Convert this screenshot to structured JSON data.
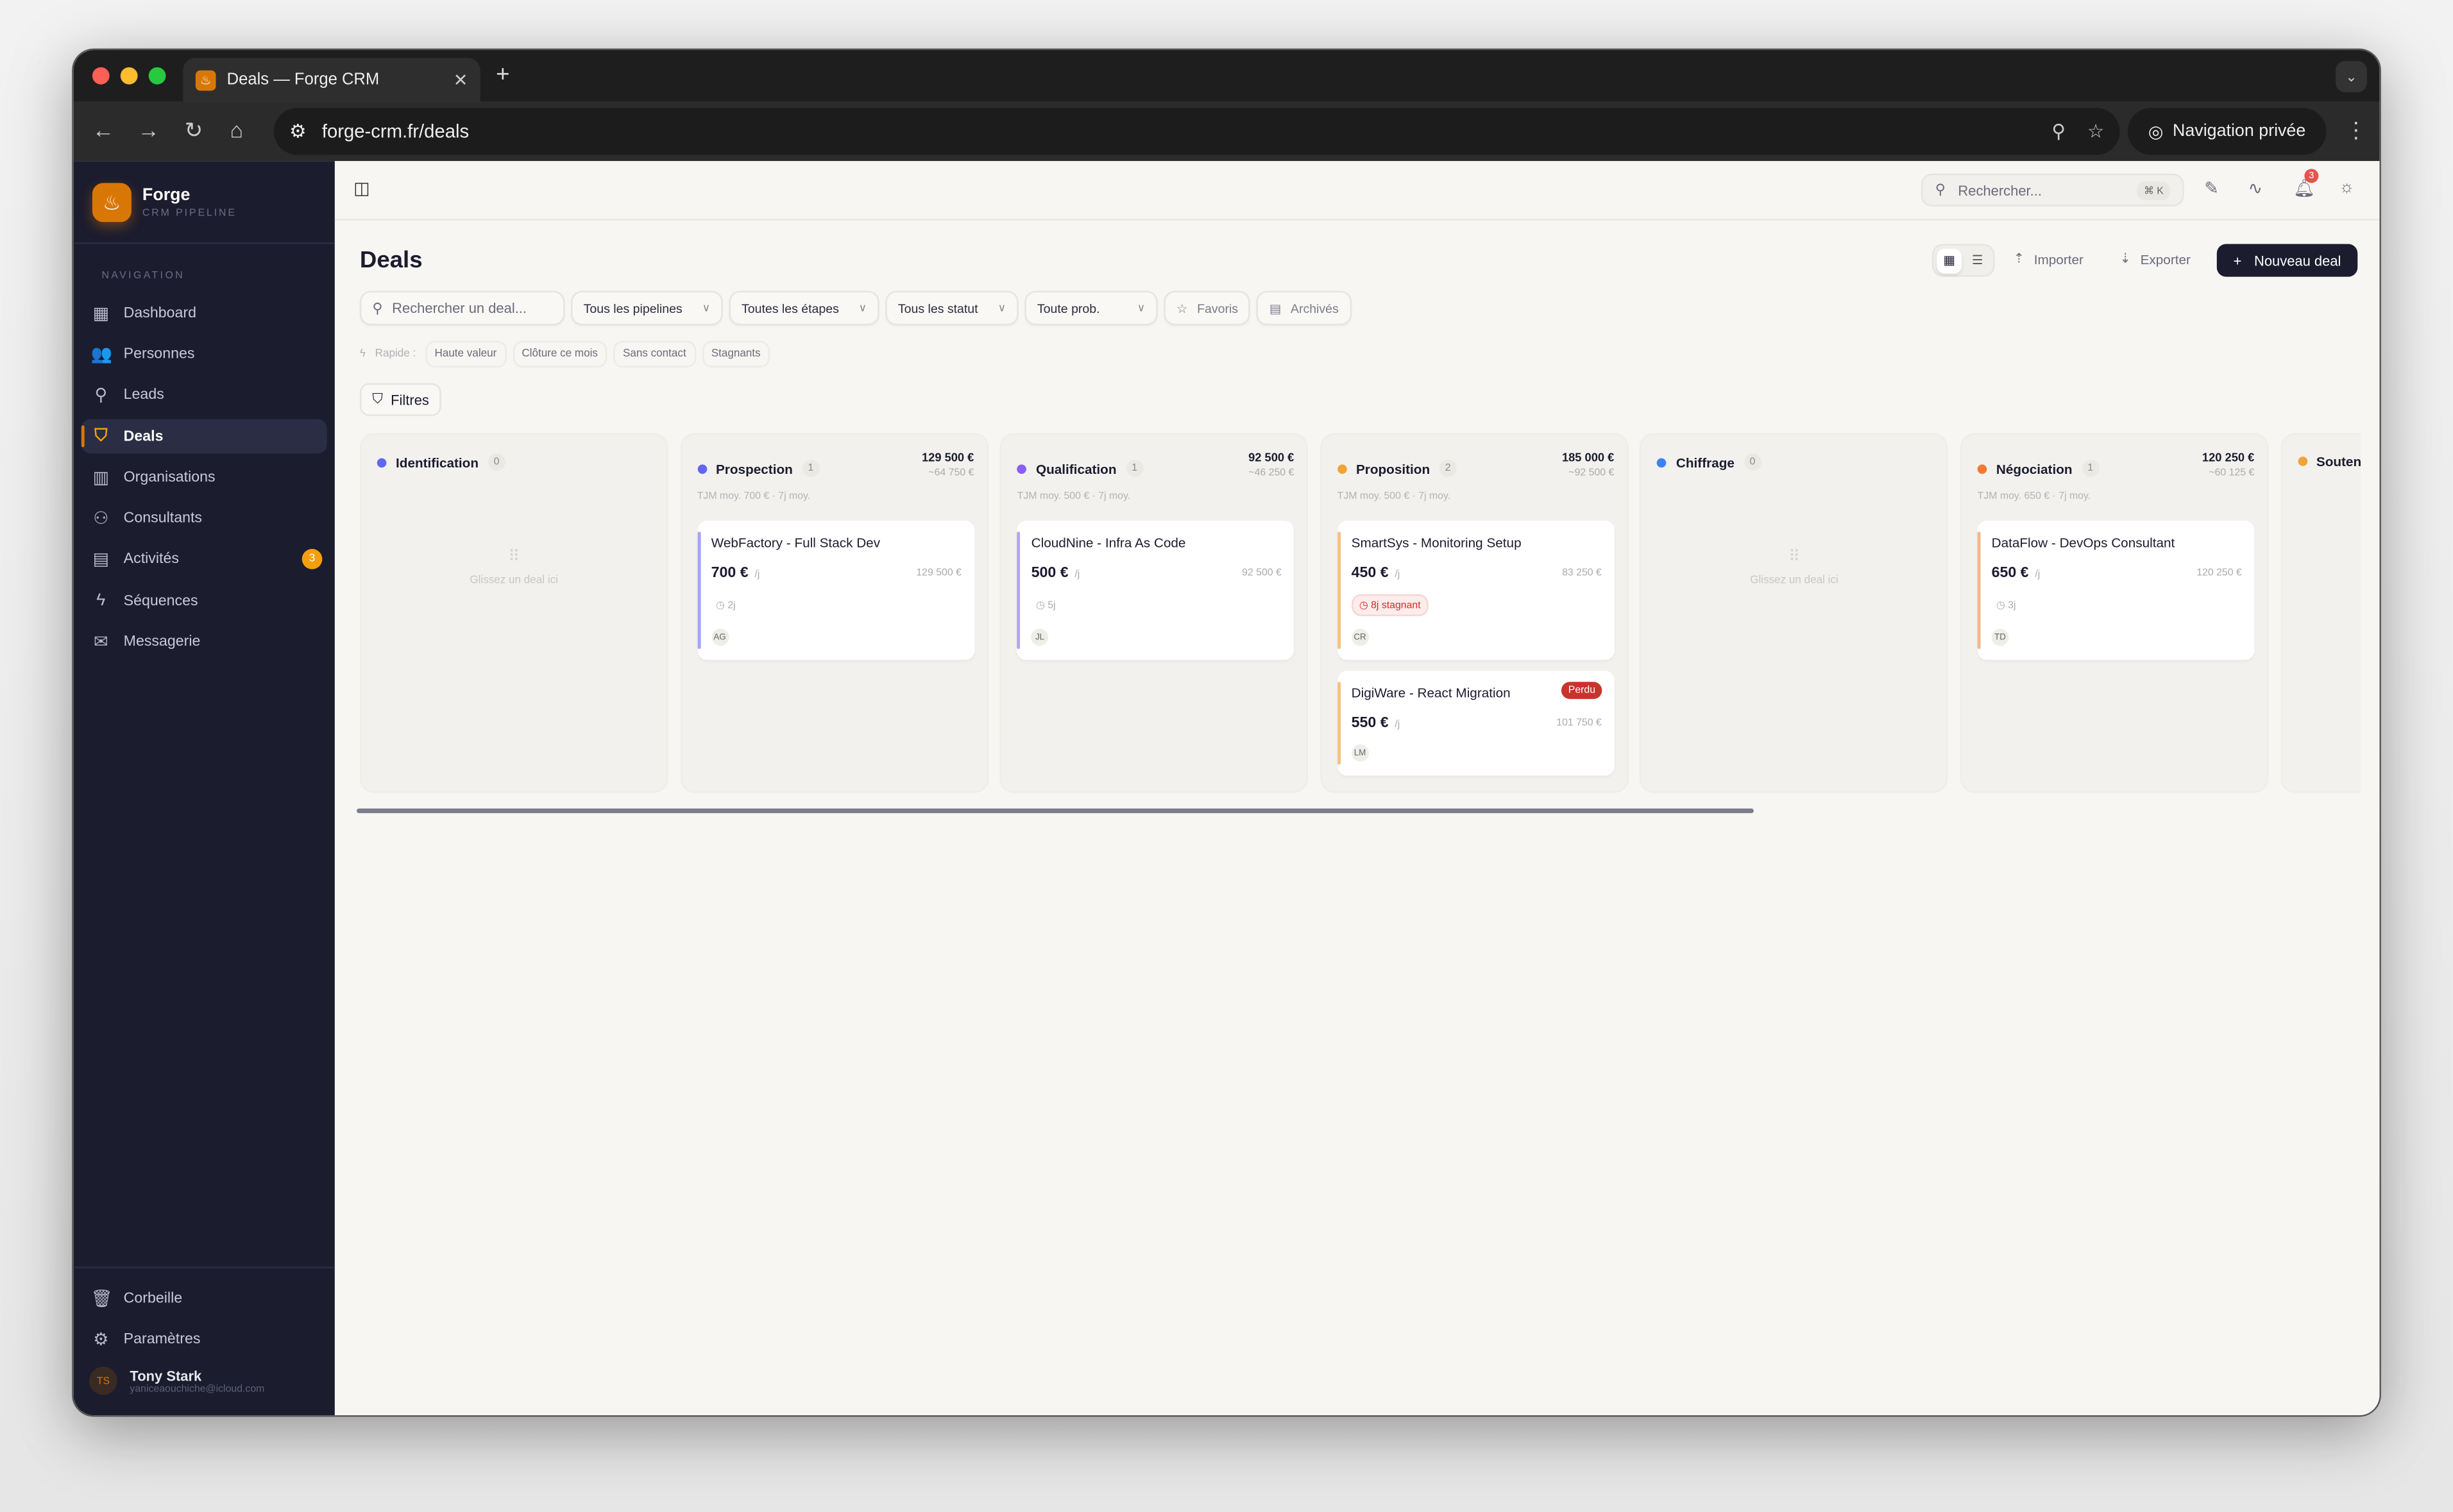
{
  "browser": {
    "tab_title": "Deals — Forge CRM",
    "url": "forge-crm.fr/deals",
    "private_label": "Navigation privée"
  },
  "sidebar": {
    "brand": "Forge",
    "brand_sub": "CRM PIPELINE",
    "section": "NAVIGATION",
    "items": [
      {
        "label": "Dashboard",
        "icon": "grid-icon",
        "glyph": "▦"
      },
      {
        "label": "Personnes",
        "icon": "users-icon",
        "glyph": "👥"
      },
      {
        "label": "Leads",
        "icon": "user-search-icon",
        "glyph": "⚲"
      },
      {
        "label": "Deals",
        "icon": "handshake-icon",
        "glyph": "⛉",
        "active": true
      },
      {
        "label": "Organisations",
        "icon": "building-icon",
        "glyph": "▥"
      },
      {
        "label": "Consultants",
        "icon": "user-cog-icon",
        "glyph": "⚇"
      },
      {
        "label": "Activités",
        "icon": "calendar-icon",
        "glyph": "▤",
        "badge": "3"
      },
      {
        "label": "Séquences",
        "icon": "zap-icon",
        "glyph": "ϟ"
      },
      {
        "label": "Messagerie",
        "icon": "mail-icon",
        "glyph": "✉"
      }
    ],
    "bottom": [
      {
        "label": "Corbeille",
        "icon": "trash-icon",
        "glyph": "🗑"
      },
      {
        "label": "Paramètres",
        "icon": "gear-icon",
        "glyph": "⚙"
      }
    ],
    "user": {
      "initials": "TS",
      "name": "Tony Stark",
      "email": "yaniceaouchiche@icloud.com"
    }
  },
  "topbar": {
    "search_placeholder": "Rechercher...",
    "shortcut": "⌘ K",
    "notifications": "3"
  },
  "page": {
    "title": "Deals",
    "import": "Importer",
    "export": "Exporter",
    "new_deal": "Nouveau deal"
  },
  "filters": {
    "search_placeholder": "Rechercher un deal...",
    "pipeline": "Tous les pipelines",
    "stage": "Toutes les étapes",
    "status": "Tous les statut",
    "prob": "Toute prob.",
    "favorites": "Favoris",
    "archived": "Archivés"
  },
  "quick": {
    "label": "Rapide :",
    "chips": [
      "Haute valeur",
      "Clôture ce mois",
      "Sans contact",
      "Stagnants"
    ]
  },
  "filters_button": "Filtres",
  "empty_text": "Glissez un deal ici",
  "columns": [
    {
      "name": "Identification",
      "count": "0",
      "color": "#6366f1",
      "cards": []
    },
    {
      "name": "Prospection",
      "count": "1",
      "color": "#6366f1",
      "total": "129 500 €",
      "weighted": "~64 750 €",
      "meta": "TJM moy. 700 € · 7j moy.",
      "cards": [
        {
          "title": "WebFactory - Full Stack Dev",
          "rate": "700 €",
          "unit": "/j",
          "amount": "129 500 €",
          "age": "2j",
          "initials": "AG",
          "accent": "#a5a3f5"
        }
      ]
    },
    {
      "name": "Qualification",
      "count": "1",
      "color": "#8b5cf6",
      "total": "92 500 €",
      "weighted": "~46 250 €",
      "meta": "TJM moy. 500 € · 7j moy.",
      "cards": [
        {
          "title": "CloudNine - Infra As Code",
          "rate": "500 €",
          "unit": "/j",
          "amount": "92 500 €",
          "age": "5j",
          "initials": "JL",
          "accent": "#b7a3f5"
        }
      ]
    },
    {
      "name": "Proposition",
      "count": "2",
      "color": "#f0a336",
      "total": "185 000 €",
      "weighted": "~92 500 €",
      "meta": "TJM moy. 500 € · 7j moy.",
      "cards": [
        {
          "title": "SmartSys - Monitoring Setup",
          "rate": "450 €",
          "unit": "/j",
          "amount": "83 250 €",
          "stagnant": "8j stagnant",
          "initials": "CR",
          "accent": "#f5c27a"
        },
        {
          "title": "DigiWare - React Migration",
          "rate": "550 €",
          "unit": "/j",
          "amount": "101 750 €",
          "initials": "LM",
          "status": "Perdu",
          "accent": "#f5c27a"
        }
      ]
    },
    {
      "name": "Chiffrage",
      "count": "0",
      "color": "#3b82f6",
      "cards": []
    },
    {
      "name": "Négociation",
      "count": "1",
      "color": "#f07a36",
      "total": "120 250 €",
      "weighted": "~60 125 €",
      "meta": "TJM moy. 650 € · 7j moy.",
      "cards": [
        {
          "title": "DataFlow - DevOps Consultant",
          "rate": "650 €",
          "unit": "/j",
          "amount": "120 250 €",
          "age": "3j",
          "initials": "TD",
          "accent": "#f5b58a"
        }
      ]
    },
    {
      "name": "Souten",
      "count": "",
      "color": "#f0a336",
      "cards": []
    }
  ]
}
